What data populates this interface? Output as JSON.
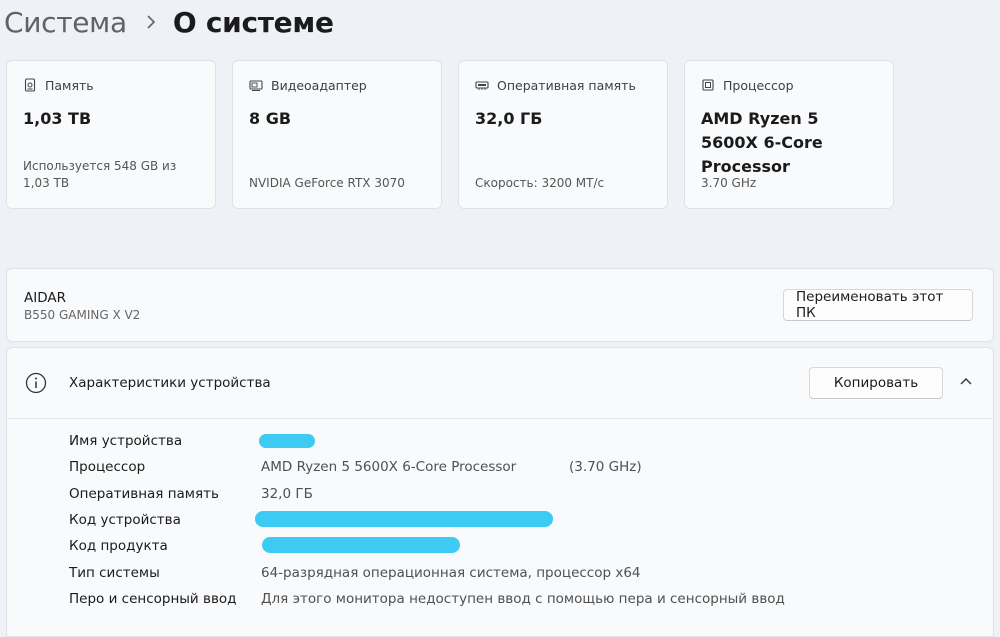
{
  "breadcrumb": {
    "parent": "Система",
    "current": "О системе"
  },
  "cards": [
    {
      "label": "Память",
      "value": "1,03 TB",
      "sub": "Используется 548 GB из 1,03 TB",
      "icon": "storage-icon"
    },
    {
      "label": "Видеоадаптер",
      "value": "8 GB",
      "sub": "NVIDIA GeForce RTX 3070",
      "icon": "gpu-icon"
    },
    {
      "label": "Оперативная память",
      "value": "32,0 ГБ",
      "sub": "Скорость: 3200 MT/c",
      "icon": "ram-icon"
    },
    {
      "label": "Процессор",
      "value": "AMD Ryzen 5 5600X 6-Core Processor",
      "sub": "3.70 GHz",
      "icon": "cpu-icon"
    }
  ],
  "pc": {
    "name": "AIDAR",
    "model": "B550 GAMING X V2",
    "rename_label": "Переименовать этот ПК"
  },
  "specs": {
    "title": "Характеристики устройства",
    "copy_label": "Копировать",
    "rows": [
      {
        "label": "Имя устройства",
        "value": ""
      },
      {
        "label": "Процессор",
        "value": "AMD Ryzen 5 5600X 6-Core Processor",
        "extra": "(3.70 GHz)"
      },
      {
        "label": "Оперативная память",
        "value": "32,0 ГБ"
      },
      {
        "label": "Код устройства",
        "value": ""
      },
      {
        "label": "Код продукта",
        "value": ""
      },
      {
        "label": "Тип системы",
        "value": "64-разрядная операционная система, процессор x64"
      },
      {
        "label": "Перо и сенсорный ввод",
        "value": "Для этого монитора недоступен ввод с помощью пера и сенсорный ввод"
      }
    ]
  },
  "colors": {
    "background": "#eef2f7",
    "card": "#f8fafc",
    "redaction": "#3ecbf3"
  }
}
